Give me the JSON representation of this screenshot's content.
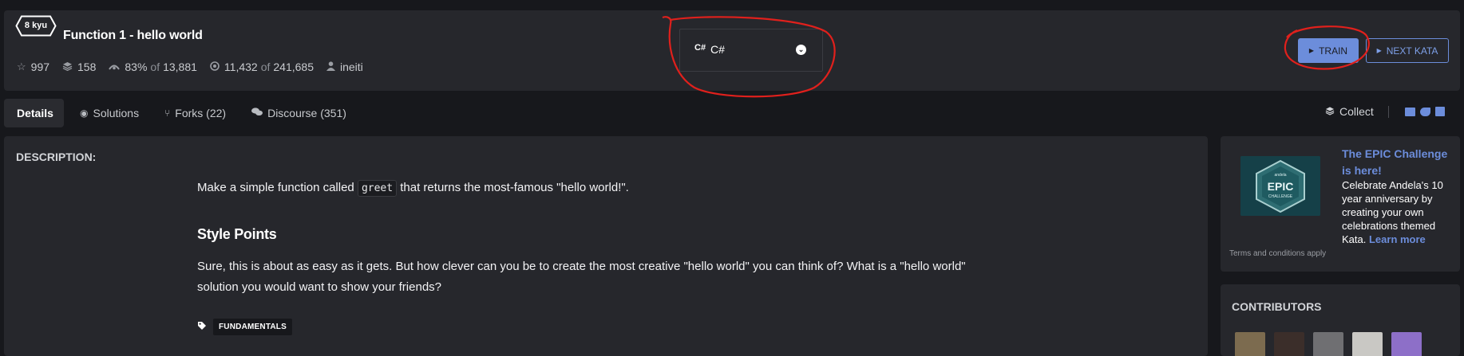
{
  "kata": {
    "rank": "8 kyu",
    "title": "Function 1 - hello world",
    "stats": {
      "stars": "997",
      "collections": "158",
      "satisfaction": "83%",
      "satisfaction_of_label": "of",
      "satisfaction_votes": "13,881",
      "completed": "11,432",
      "completed_of_label": "of",
      "attempted": "241,685",
      "author": "ineiti"
    }
  },
  "language": {
    "icon_text": "C#",
    "selected": "C#"
  },
  "actions": {
    "train_label": "TRAIN",
    "next_label": "NEXT KATA"
  },
  "tabs": [
    {
      "label": "Details",
      "active": true
    },
    {
      "label": "Solutions"
    },
    {
      "label": "Forks (22)"
    },
    {
      "label": "Discourse (351)"
    }
  ],
  "tools": {
    "collect_label": "Collect"
  },
  "description": {
    "heading": "DESCRIPTION:",
    "intro_before": "Make a simple function called",
    "intro_code": "greet",
    "intro_after": "that returns the most-famous \"hello world!\".",
    "style_heading": "Style Points",
    "style_text": "Sure, this is about as easy as it gets. But how clever can you be to create the most creative \"hello world\" you can think of? What is a \"hello world\" solution you would want to show your friends?",
    "tag": "FUNDAMENTALS"
  },
  "promo": {
    "title": "The EPIC Challenge is here!",
    "text": "Celebrate Andela's 10 year anniversary by creating your own celebrations themed Kata.",
    "link": "Learn more",
    "terms": "Terms and conditions apply",
    "badge_brand": "andela",
    "badge_title": "EPIC",
    "badge_sub": "CHALLENGE"
  },
  "contributors": {
    "heading": "CONTRIBUTORS",
    "count": 5
  },
  "colors": {
    "accent": "#6c8ddb",
    "annotation": "#e0201c",
    "panel": "#26272c",
    "background": "#17181c"
  }
}
